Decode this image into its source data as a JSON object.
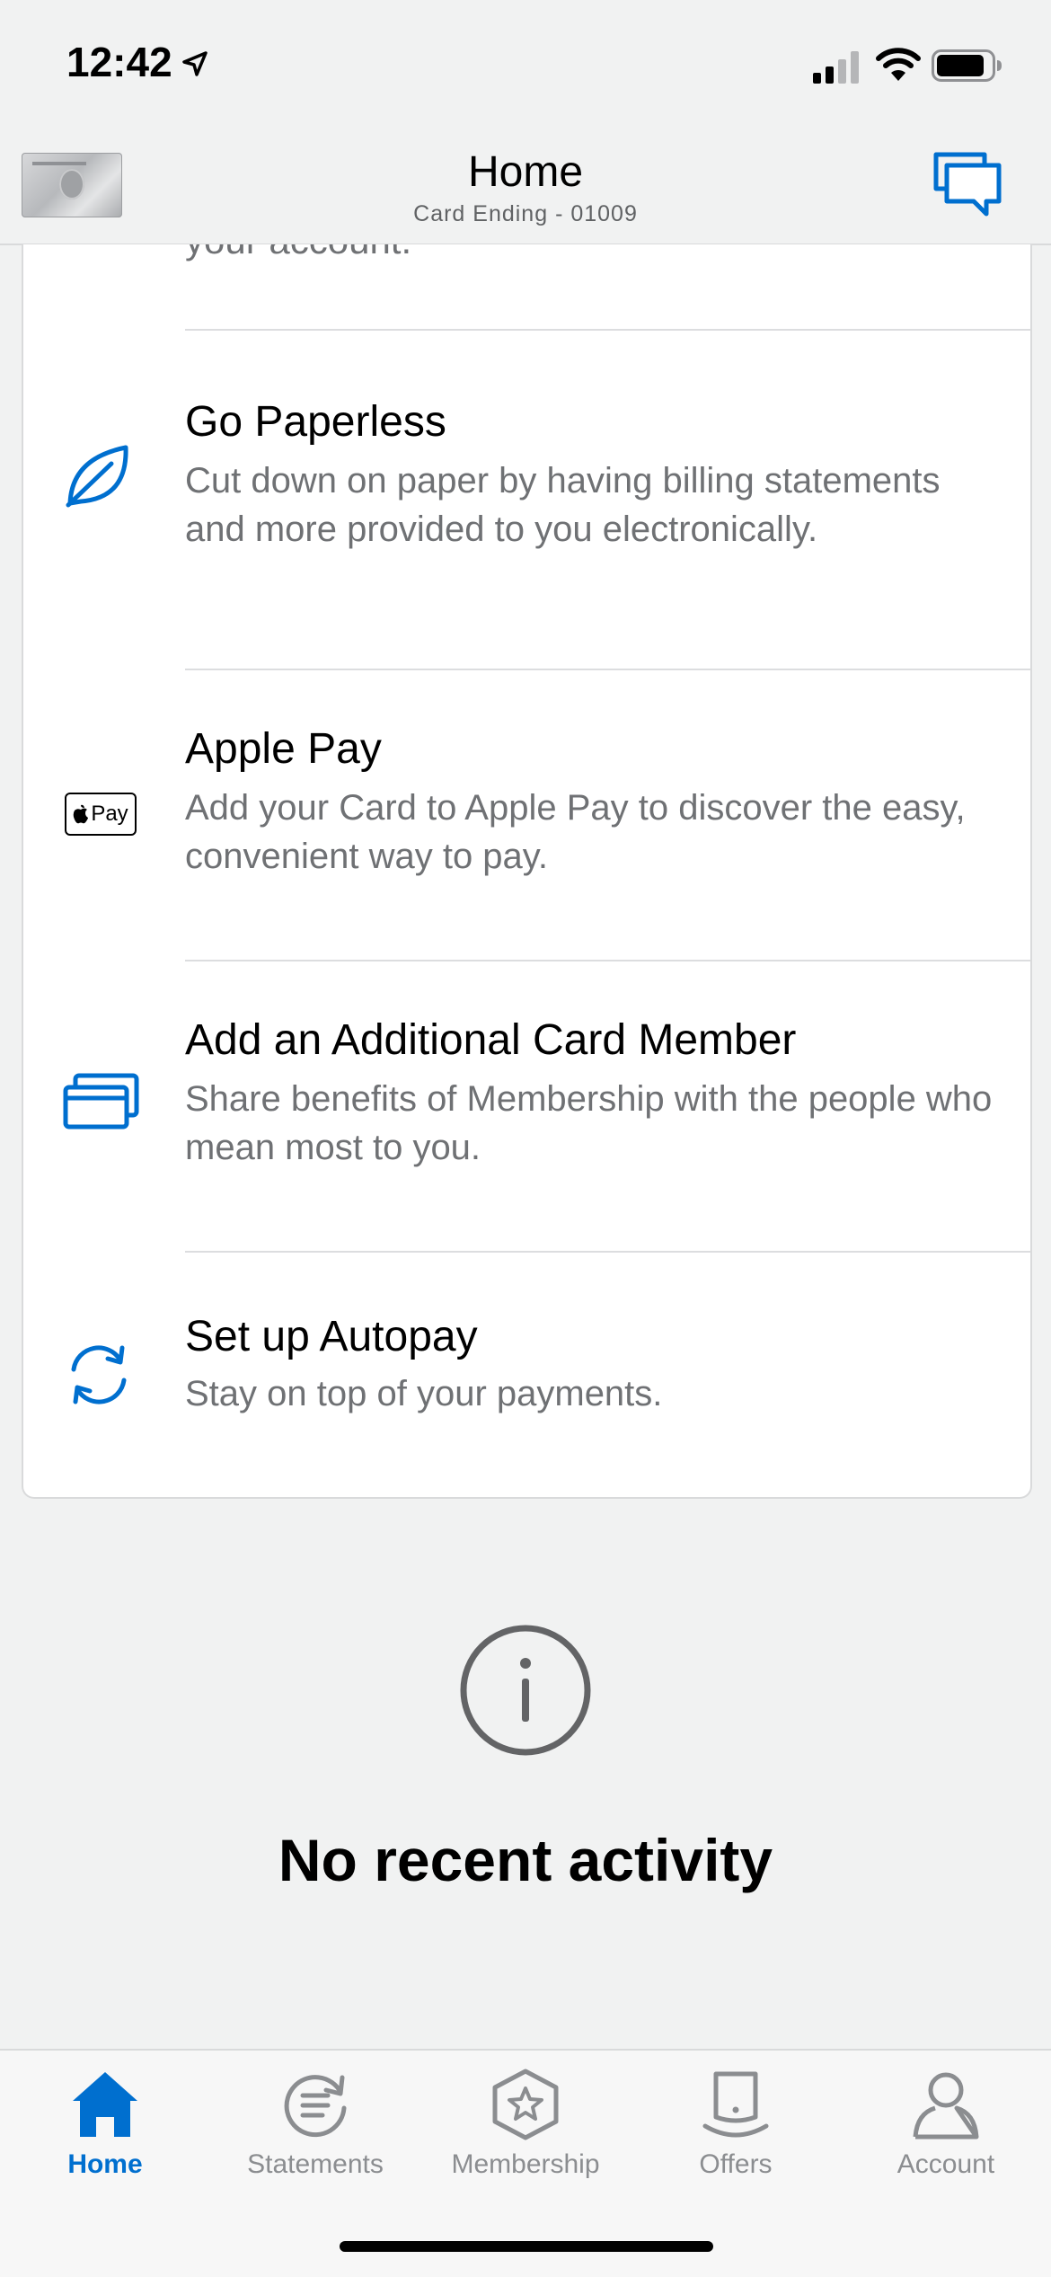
{
  "status": {
    "time": "12:42"
  },
  "header": {
    "title": "Home",
    "subtitle": "Card Ending - 01009"
  },
  "list": {
    "cut_text": "your account.",
    "items": [
      {
        "title": "Go Paperless",
        "description": "Cut down on paper by having billing statements and more provided to you electronically.",
        "icon": "leaf-icon"
      },
      {
        "title": "Apple Pay",
        "description": "Add your Card to Apple Pay to discover the easy, convenient way to pay.",
        "icon": "apple-pay-icon",
        "badge": "Pay"
      },
      {
        "title": "Add an Additional Card Member",
        "description": "Share benefits of Membership with the people who mean most to you.",
        "icon": "cards-icon"
      },
      {
        "title": "Set up Autopay",
        "description": "Stay on top of your payments.",
        "icon": "refresh-icon"
      }
    ]
  },
  "empty_state": {
    "text": "No recent activity",
    "icon": "info-icon"
  },
  "tabs": [
    {
      "label": "Home",
      "icon": "home-icon",
      "active": true
    },
    {
      "label": "Statements",
      "icon": "statements-icon",
      "active": false
    },
    {
      "label": "Membership",
      "icon": "membership-icon",
      "active": false
    },
    {
      "label": "Offers",
      "icon": "offers-icon",
      "active": false
    },
    {
      "label": "Account",
      "icon": "account-icon",
      "active": false
    }
  ],
  "colors": {
    "accent": "#006fcf",
    "inactive": "#8b8d90",
    "background": "#f1f2f2"
  }
}
